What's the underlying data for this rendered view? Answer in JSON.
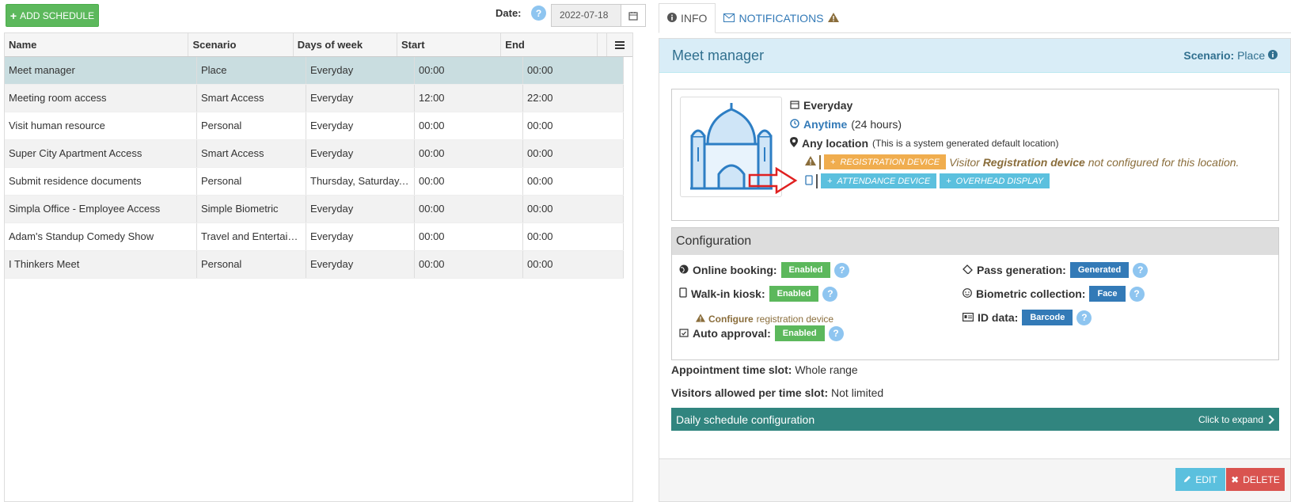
{
  "toolbar": {
    "add_schedule_label": "ADD SCHEDULE",
    "date_label": "Date:",
    "date_value": "2022-07-18"
  },
  "grid": {
    "columns": [
      "Name",
      "Scenario",
      "Days of week",
      "Start",
      "End"
    ],
    "rows": [
      {
        "name": "Meet manager",
        "scenario": "Place",
        "days": "Everyday",
        "start": "00:00",
        "end": "00:00"
      },
      {
        "name": "Meeting room access",
        "scenario": "Smart Access",
        "days": "Everyday",
        "start": "12:00",
        "end": "22:00"
      },
      {
        "name": "Visit human resource",
        "scenario": "Personal",
        "days": "Everyday",
        "start": "00:00",
        "end": "00:00"
      },
      {
        "name": "Super City Apartment Access",
        "scenario": "Smart Access",
        "days": "Everyday",
        "start": "00:00",
        "end": "00:00"
      },
      {
        "name": "Submit residence documents",
        "scenario": "Personal",
        "days": "Thursday, Saturday, ...",
        "start": "00:00",
        "end": "00:00"
      },
      {
        "name": "Simpla Office - Employee Access",
        "scenario": "Simple Biometric",
        "days": "Everyday",
        "start": "00:00",
        "end": "00:00"
      },
      {
        "name": "Adam's Standup Comedy Show",
        "scenario": "Travel and Entertain...",
        "days": "Everyday",
        "start": "00:00",
        "end": "00:00"
      },
      {
        "name": "I Thinkers Meet",
        "scenario": "Personal",
        "days": "Everyday",
        "start": "00:00",
        "end": "00:00"
      }
    ]
  },
  "tabs": {
    "info": "INFO",
    "notifications": "NOTIFICATIONS"
  },
  "detail": {
    "title": "Meet manager",
    "scenario_label": "Scenario:",
    "scenario_value": "Place",
    "days": "Everyday",
    "time_link": "Anytime",
    "time_note": "(24 hours)",
    "location": "Any location",
    "location_note": "(This is a system generated default location)",
    "registration_device": "REGISTRATION DEVICE",
    "reg_warning_pre": "Visitor",
    "reg_warning_bold": "Registration device",
    "reg_warning_post": "not configured for this location.",
    "attendance_device": "ATTENDANCE DEVICE",
    "overhead_display": "OVERHEAD DISPLAY"
  },
  "config": {
    "title": "Configuration",
    "online_booking_label": "Online booking:",
    "online_booking_value": "Enabled",
    "walkin_label": "Walk-in kiosk:",
    "walkin_value": "Enabled",
    "configure_link": "Configure",
    "configure_rest": "registration device",
    "auto_approval_label": "Auto approval:",
    "auto_approval_value": "Enabled",
    "pass_label": "Pass generation:",
    "pass_value": "Generated",
    "biometric_label": "Biometric collection:",
    "biometric_value": "Face",
    "id_label": "ID data:",
    "id_value": "Barcode"
  },
  "extra": {
    "slot_label": "Appointment time slot:",
    "slot_value": "Whole range",
    "visitors_label": "Visitors allowed per time slot:",
    "visitors_value": "Not limited",
    "daily_title": "Daily schedule configuration",
    "daily_expand": "Click to expand"
  },
  "footer": {
    "edit": "EDIT",
    "delete": "DELETE"
  },
  "colors": {
    "success": "#5cb85c",
    "primary": "#337ab7",
    "info": "#5bc0de",
    "warning": "#f0ad4e",
    "danger": "#d9534f",
    "teal": "#31857f"
  }
}
